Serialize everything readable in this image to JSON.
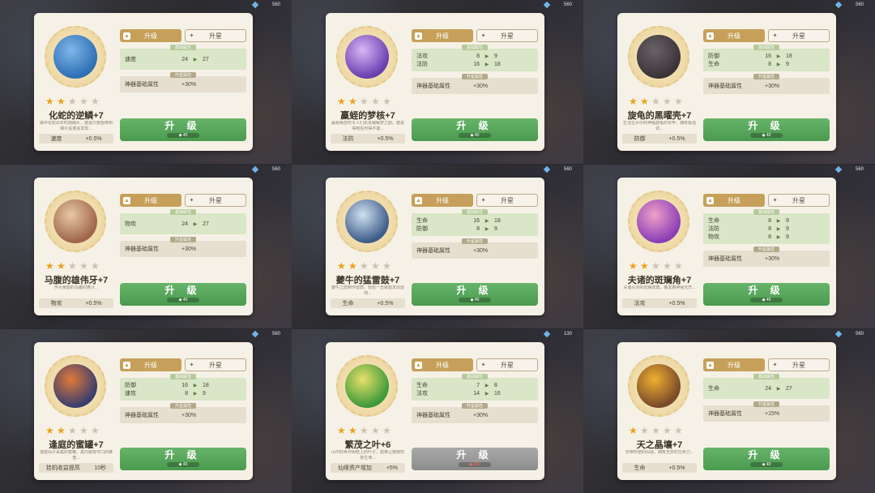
{
  "tabs": {
    "upgrade": "升级",
    "star": "升星"
  },
  "section_base": "基础属性",
  "section_up": "升星属性",
  "button_label": "升 级",
  "cells": [
    {
      "name": "化蛇的逆鳞+7",
      "stars": 2,
      "desc": "域中化蛇幼年时期鳞片，据说只要能够到鳞片后便会发现...",
      "effect_k": "速度",
      "effect_v": "+0.5%",
      "stats": [
        {
          "k": "速度",
          "a": "24",
          "b": "27"
        }
      ],
      "extra_k": "神器基础属性",
      "extra_v": "+30%",
      "cost": "40",
      "coin": "560",
      "btn_gray": false,
      "item_colors": [
        "#2e6fb5",
        "#7fb7e8"
      ]
    },
    {
      "name": "蠃蛭的梦核+7",
      "stars": 2,
      "desc": "蠃蛭栖息时令人们失去睡眠梦之韵。据说得到后可得不能...",
      "effect_k": "法防",
      "effect_v": "+0.5%",
      "stats": [
        {
          "k": "法攻",
          "a": "8",
          "b": "9"
        },
        {
          "k": "法防",
          "a": "16",
          "b": "18"
        }
      ],
      "extra_k": "神器基础属性",
      "extra_v": "+30%",
      "cost": "40",
      "coin": "560",
      "btn_gray": false,
      "item_colors": [
        "#6a3fb0",
        "#d9b6f5"
      ]
    },
    {
      "name": "旋龟的黑曜壳+7",
      "stars": 2,
      "desc": "生活在水中的神龟旋龟的背甲，拥有极强的...",
      "effect_k": "防御",
      "effect_v": "+0.5%",
      "stats": [
        {
          "k": "防御",
          "a": "16",
          "b": "18"
        },
        {
          "k": "生命",
          "a": "8",
          "b": "9"
        }
      ],
      "extra_k": "神器基础属性",
      "extra_v": "+30%",
      "cost": "40",
      "coin": "560",
      "btn_gray": false,
      "item_colors": [
        "#3a3438",
        "#6a6268"
      ]
    },
    {
      "name": "马腹的雄伟牙+7",
      "stars": 2,
      "desc": "作为食能的马腹的獠牙...",
      "effect_k": "物攻",
      "effect_v": "+0.5%",
      "stats": [
        {
          "k": "物攻",
          "a": "24",
          "b": "27"
        }
      ],
      "extra_k": "神器基础属性",
      "extra_v": "+30%",
      "cost": "40",
      "coin": "560",
      "btn_gray": false,
      "item_colors": [
        "#a0664a",
        "#e8c8a6"
      ]
    },
    {
      "name": "夔牛的猛雷鼓+7",
      "stars": 2,
      "desc": "夔牛之皮制作雷鼓，轻轻一击就能发出雷鸣...",
      "effect_k": "生命",
      "effect_v": "+0.5%",
      "stats": [
        {
          "k": "生命",
          "a": "16",
          "b": "18"
        },
        {
          "k": "防御",
          "a": "8",
          "b": "9"
        }
      ],
      "extra_k": "神器基础属性",
      "extra_v": "+30%",
      "cost": "40",
      "coin": "560",
      "btn_gray": false,
      "item_colors": [
        "#3f5d8a",
        "#cfe2f0"
      ]
    },
    {
      "name": "夫诸的斑斓角+7",
      "stars": 2,
      "desc": "夫诸头顶的斑斓双角，散发着神秘光芒...",
      "effect_k": "法攻",
      "effect_v": "+0.5%",
      "stats": [
        {
          "k": "生命",
          "a": "8",
          "b": "9"
        },
        {
          "k": "法防",
          "a": "8",
          "b": "9"
        },
        {
          "k": "物攻",
          "a": "8",
          "b": "9"
        }
      ],
      "extra_k": "神器基础属性",
      "extra_v": "+30%",
      "cost": "40",
      "coin": "560",
      "btn_gray": false,
      "item_colors": [
        "#8a3fb5",
        "#f0a0c8"
      ]
    },
    {
      "name": "逢庭的蜜罐+7",
      "stars": 2,
      "desc": "逢庭仙子采集的蜜罐，其内装有可口的蜂蜜...",
      "effect_k": "挂机收益提高",
      "effect_v": "10秒",
      "stats": [
        {
          "k": "防御",
          "a": "16",
          "b": "18"
        },
        {
          "k": "速攻",
          "a": "8",
          "b": "9"
        }
      ],
      "extra_k": "神器基础属性",
      "extra_v": "+30%",
      "cost": "40",
      "coin": "560",
      "btn_gray": false,
      "item_colors": [
        "#3a3d6e",
        "#e07a3a"
      ]
    },
    {
      "name": "繁茂之叶+6",
      "stars": 2,
      "desc": "山中的世界树枝上的叶子，能够让植物恢复生命...",
      "effect_k": "仙缘资产增加",
      "effect_v": "+5%",
      "stats": [
        {
          "k": "生命",
          "a": "7",
          "b": "8"
        },
        {
          "k": "法攻",
          "a": "14",
          "b": "16"
        }
      ],
      "extra_k": "神器基础属性",
      "extra_v": "+30%",
      "cost": "300",
      "coin": "130",
      "btn_gray": true,
      "item_colors": [
        "#3f9a3a",
        "#e6e06a"
      ]
    },
    {
      "name": "天之晶壤+7",
      "stars": 1,
      "desc": "天帝所使的仙壤，拥有无穷的生命力...",
      "effect_k": "生命",
      "effect_v": "+0.5%",
      "stats": [
        {
          "k": "生命",
          "a": "24",
          "b": "27"
        }
      ],
      "extra_k": "神器基础属性",
      "extra_v": "+15%",
      "cost": "40",
      "coin": "560",
      "btn_gray": false,
      "item_colors": [
        "#7a4a2a",
        "#f0b030"
      ]
    }
  ]
}
